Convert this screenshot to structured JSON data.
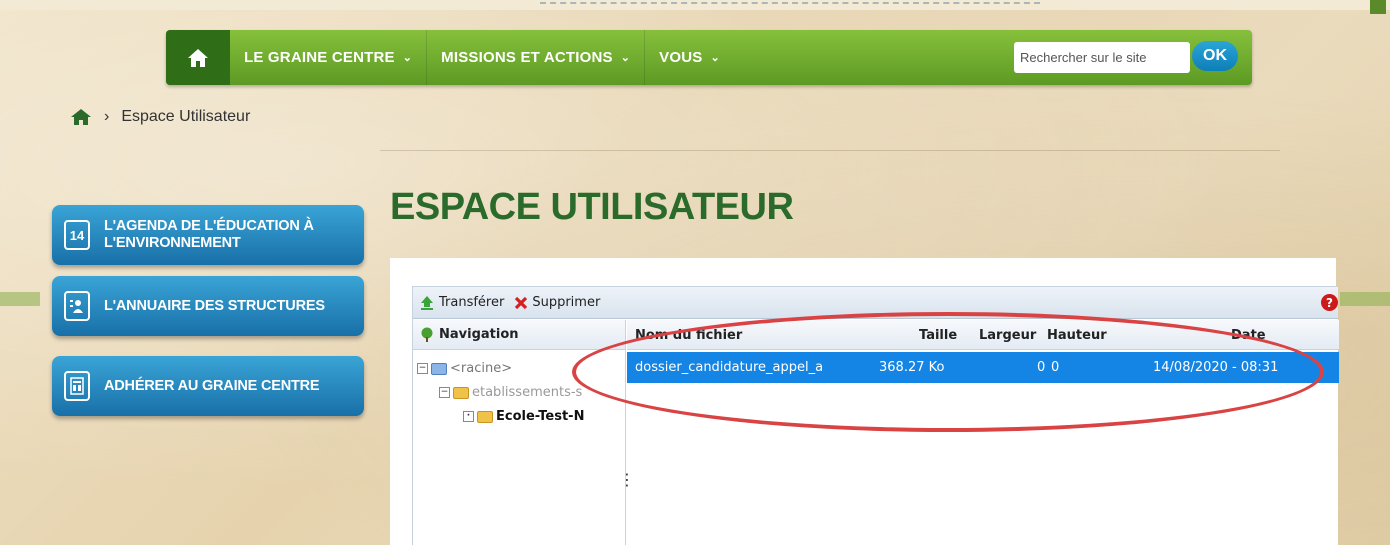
{
  "nav": {
    "items": [
      {
        "label": "LE GRAINE CENTRE"
      },
      {
        "label": "MISSIONS ET ACTIONS"
      },
      {
        "label": "VOUS"
      }
    ],
    "search_placeholder": "Rechercher sur le site",
    "search_button": "OK"
  },
  "breadcrumb": {
    "separator": "›",
    "current": "Espace Utilisateur"
  },
  "page_title": "ESPACE UTILISATEUR",
  "sidebar": {
    "items": [
      {
        "label_line1": "L'AGENDA DE L'ÉDUCATION À",
        "label_line2": "L'ENVIRONNEMENT",
        "icon_text": "14"
      },
      {
        "label_line1": "L'ANNUAIRE DES STRUCTURES",
        "label_line2": ""
      },
      {
        "label_line1": "ADHÉRER AU GRAINE CENTRE",
        "label_line2": ""
      }
    ]
  },
  "file_manager": {
    "toolbar": {
      "upload_label": "Transférer",
      "delete_label": "Supprimer"
    },
    "tree": {
      "header": "Navigation",
      "nodes": [
        {
          "label": "<racine>"
        },
        {
          "label": "etablissements-s"
        },
        {
          "label": "Ecole-Test-N"
        }
      ]
    },
    "columns": {
      "name": "Nom du fichier",
      "size": "Taille",
      "width": "Largeur",
      "height": "Hauteur",
      "date": "Date"
    },
    "files": [
      {
        "name": "dossier_candidature_appel_a",
        "size": "368.27 Ko",
        "width": "0",
        "height": "0",
        "date": "14/08/2020 - 08:31"
      }
    ]
  },
  "colors": {
    "nav_green": "#6eab2e",
    "nav_home_green": "#2f6d17",
    "button_blue": "#2a8fc6",
    "title_green": "#2a6a2a",
    "selected_row": "#1585e5",
    "annotation_red": "#d94343"
  }
}
